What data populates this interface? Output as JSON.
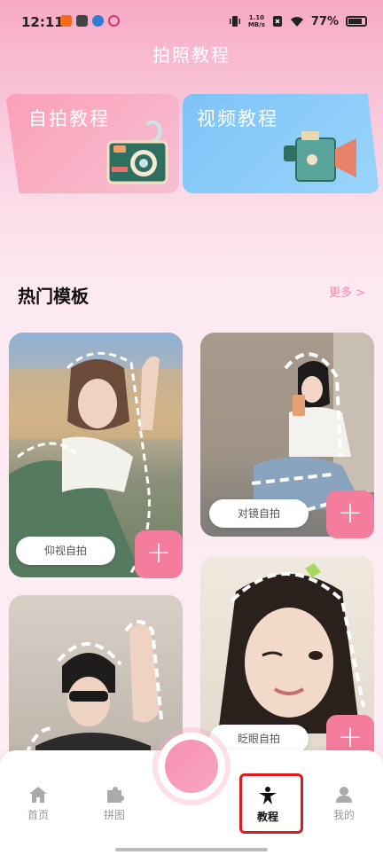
{
  "status": {
    "time": "12:11",
    "netspeed_top": "1.10",
    "netspeed_bottom": "MB/s",
    "battery": "77%"
  },
  "header": {
    "title": "拍照教程"
  },
  "cards": {
    "selfie_label": "自拍教程",
    "video_label": "视频教程"
  },
  "section": {
    "title": "热门模板",
    "more": "更多 >"
  },
  "templates": [
    {
      "label": "仰视自拍"
    },
    {
      "label": "对镜自拍"
    },
    {
      "label": "眨眼自拍"
    },
    {
      "label": ""
    }
  ],
  "tabs": [
    {
      "label": "首页"
    },
    {
      "label": "拼图"
    },
    {
      "label": "教程"
    },
    {
      "label": "我的"
    }
  ],
  "plus_symbol": "+",
  "colors": {
    "accent": "#f47c9c",
    "selfie_card": "#fb9fb8",
    "video_card": "#7ec3f7",
    "highlight": "#e0191f"
  }
}
